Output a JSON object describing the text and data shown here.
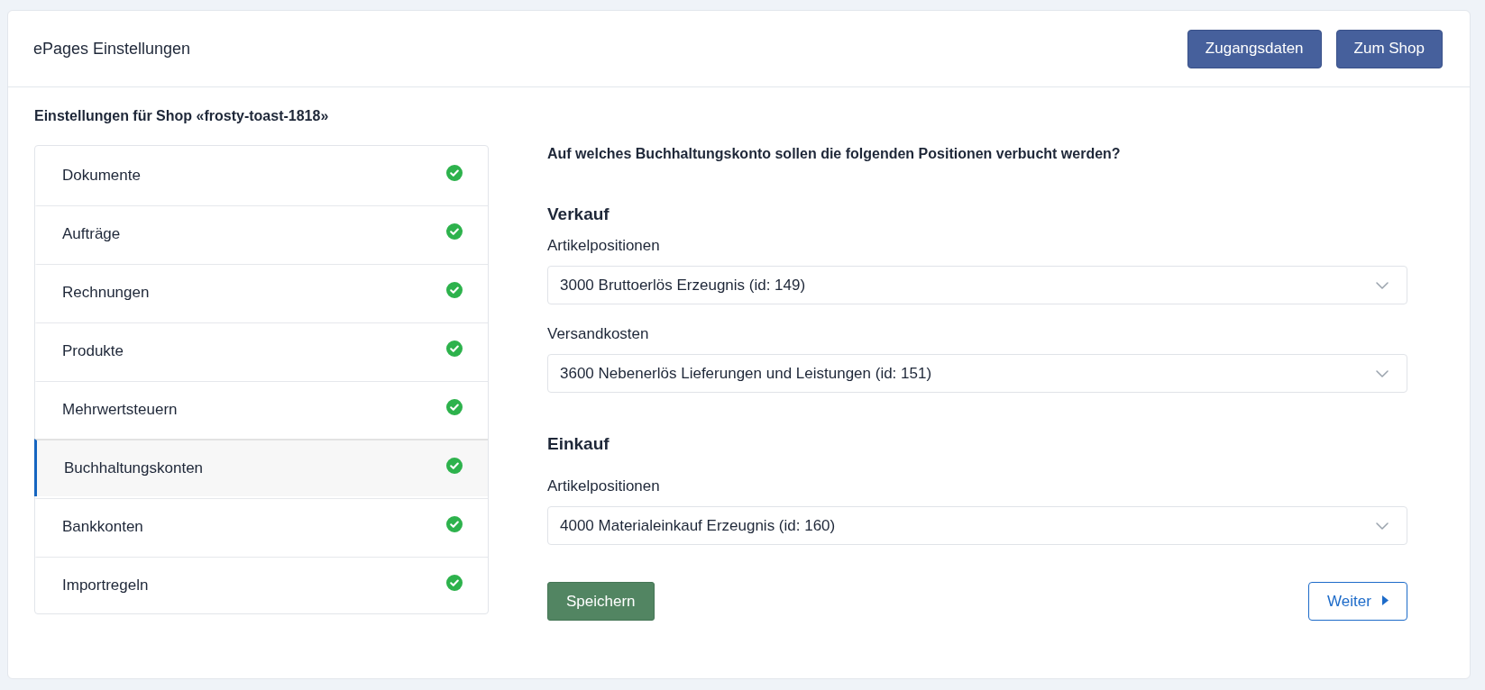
{
  "header": {
    "title": "ePages Einstellungen",
    "buttons": [
      "Zugangsdaten",
      "Zum Shop"
    ]
  },
  "shop_heading": "Einstellungen für Shop «frosty-toast-1818»",
  "sidebar": {
    "items": [
      {
        "label": "Dokumente",
        "selected": false,
        "done": true
      },
      {
        "label": "Aufträge",
        "selected": false,
        "done": true
      },
      {
        "label": "Rechnungen",
        "selected": false,
        "done": true
      },
      {
        "label": "Produkte",
        "selected": false,
        "done": true
      },
      {
        "label": "Mehrwertsteuern",
        "selected": false,
        "done": true
      },
      {
        "label": "Buchhaltungskonten",
        "selected": true,
        "done": true
      },
      {
        "label": "Bankkonten",
        "selected": false,
        "done": true
      },
      {
        "label": "Importregeln",
        "selected": false,
        "done": true
      }
    ]
  },
  "form": {
    "question": "Auf welches Buchhaltungskonto sollen die folgenden Positionen verbucht werden?",
    "sections": [
      {
        "title": "Verkauf",
        "fields": [
          {
            "label": "Artikelpositionen",
            "value": "3000 Bruttoerlös Erzeugnis (id: 149)"
          },
          {
            "label": "Versandkosten",
            "value": "3600 Nebenerlös Lieferungen und Leistungen (id: 151)"
          }
        ]
      },
      {
        "title": "Einkauf",
        "fields": [
          {
            "label": "Artikelpositionen",
            "value": "4000 Materialeinkauf Erzeugnis (id: 160)"
          }
        ]
      }
    ],
    "save_button": "Speichern",
    "next_button": "Weiter"
  }
}
